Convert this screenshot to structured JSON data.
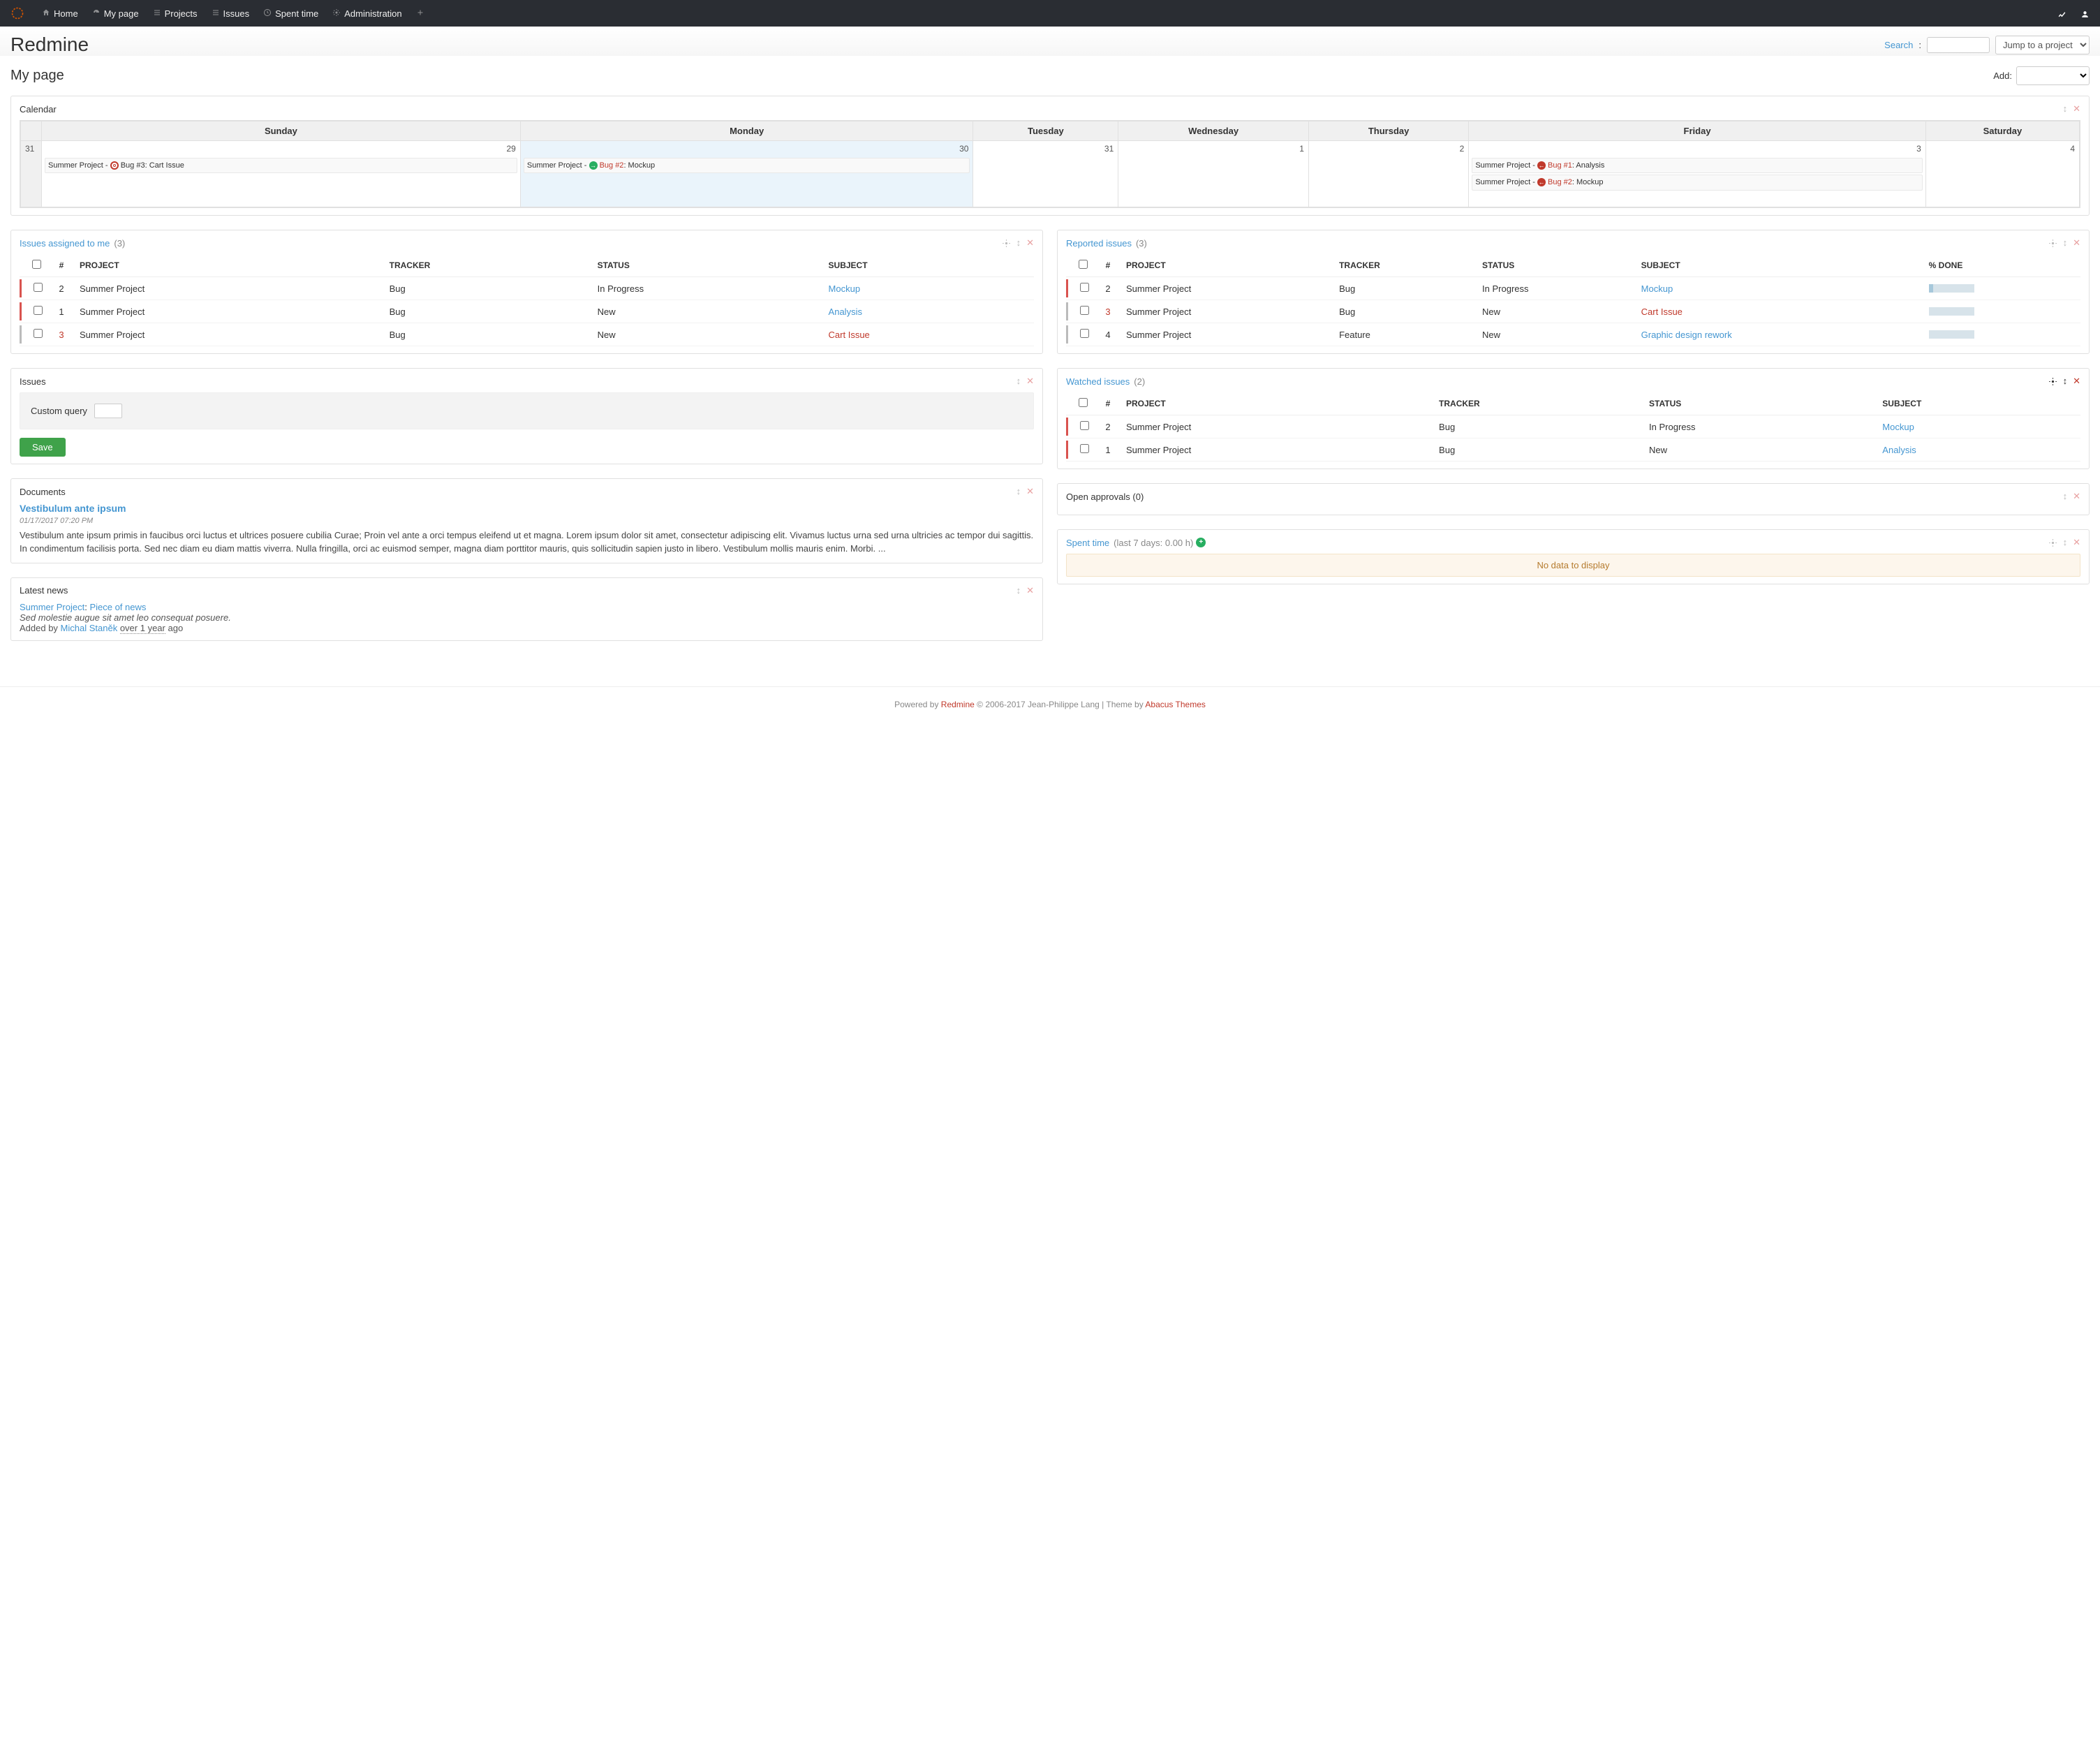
{
  "nav": {
    "items": [
      {
        "label": "Home",
        "icon": "home"
      },
      {
        "label": "My page",
        "icon": "dashboard"
      },
      {
        "label": "Projects",
        "icon": "list"
      },
      {
        "label": "Issues",
        "icon": "list"
      },
      {
        "label": "Spent time",
        "icon": "clock"
      },
      {
        "label": "Administration",
        "icon": "gear"
      }
    ]
  },
  "header": {
    "app_title": "Redmine",
    "search_label": "Search",
    "jump_placeholder": "Jump to a project..."
  },
  "page": {
    "title": "My page",
    "add_label": "Add:"
  },
  "calendar": {
    "title": "Calendar",
    "days": [
      "Sunday",
      "Monday",
      "Tuesday",
      "Wednesday",
      "Thursday",
      "Friday",
      "Saturday"
    ],
    "week_number": "31",
    "cells": [
      {
        "num": "29",
        "today": false,
        "events": [
          {
            "project": "Summer Project",
            "issue": "Bug #3",
            "subject": "Cart Issue",
            "icon": "target",
            "link_color": "black"
          }
        ]
      },
      {
        "num": "30",
        "today": true,
        "events": [
          {
            "project": "Summer Project",
            "issue": "Bug #2",
            "subject": "Mockup",
            "icon": "go",
            "link_color": "red"
          }
        ]
      },
      {
        "num": "31",
        "today": false,
        "events": []
      },
      {
        "num": "1",
        "today": false,
        "events": []
      },
      {
        "num": "2",
        "today": false,
        "events": []
      },
      {
        "num": "3",
        "today": false,
        "events": [
          {
            "project": "Summer Project",
            "issue": "Bug #1",
            "subject": "Analysis",
            "icon": "back",
            "link_color": "red"
          },
          {
            "project": "Summer Project",
            "issue": "Bug #2",
            "subject": "Mockup",
            "icon": "back",
            "link_color": "red"
          }
        ]
      },
      {
        "num": "4",
        "today": false,
        "events": []
      }
    ]
  },
  "assigned": {
    "title": "Issues assigned to me",
    "count": "(3)",
    "headers": [
      "#",
      "PROJECT",
      "TRACKER",
      "STATUS",
      "SUBJECT"
    ],
    "rows": [
      {
        "priority": "red",
        "id": "2",
        "project": "Summer Project",
        "tracker": "Bug",
        "status": "In Progress",
        "subject": "Mockup",
        "subject_color": "link"
      },
      {
        "priority": "red",
        "id": "1",
        "project": "Summer Project",
        "tracker": "Bug",
        "status": "New",
        "subject": "Analysis",
        "subject_color": "link"
      },
      {
        "priority": "grey",
        "id": "3",
        "id_color": "red",
        "project": "Summer Project",
        "tracker": "Bug",
        "status": "New",
        "subject": "Cart Issue",
        "subject_color": "red"
      }
    ]
  },
  "reported": {
    "title": "Reported issues",
    "count": "(3)",
    "headers": [
      "#",
      "PROJECT",
      "TRACKER",
      "STATUS",
      "SUBJECT",
      "% DONE"
    ],
    "rows": [
      {
        "priority": "red",
        "id": "2",
        "project": "Summer Project",
        "tracker": "Bug",
        "status": "In Progress",
        "subject": "Mockup",
        "subject_color": "link",
        "done": 10
      },
      {
        "priority": "grey",
        "id": "3",
        "id_color": "red",
        "project": "Summer Project",
        "tracker": "Bug",
        "status": "New",
        "subject": "Cart Issue",
        "subject_color": "red",
        "done": 0
      },
      {
        "priority": "grey",
        "id": "4",
        "project": "Summer Project",
        "tracker": "Feature",
        "status": "New",
        "subject": "Graphic design rework",
        "subject_color": "link",
        "done": 0
      }
    ]
  },
  "issues_box": {
    "title": "Issues",
    "query_label": "Custom query",
    "save_label": "Save"
  },
  "watched": {
    "title": "Watched issues",
    "count": "(2)",
    "headers": [
      "#",
      "PROJECT",
      "TRACKER",
      "STATUS",
      "SUBJECT"
    ],
    "rows": [
      {
        "priority": "red",
        "id": "2",
        "project": "Summer Project",
        "tracker": "Bug",
        "status": "In Progress",
        "subject": "Mockup"
      },
      {
        "priority": "red",
        "id": "1",
        "project": "Summer Project",
        "tracker": "Bug",
        "status": "New",
        "subject": "Analysis"
      }
    ]
  },
  "approvals": {
    "title": "Open approvals (0)"
  },
  "documents": {
    "title": "Documents",
    "doc_title": "Vestibulum ante ipsum",
    "date": "01/17/2017 07:20 PM",
    "body": "Vestibulum ante ipsum primis in faucibus orci luctus et ultrices posuere cubilia Curae; Proin vel ante a orci tempus eleifend ut et magna. Lorem ipsum dolor sit amet, consectetur adipiscing elit. Vivamus luctus urna sed urna ultricies ac tempor dui sagittis. In condimentum facilisis porta. Sed nec diam eu diam mattis viverra. Nulla fringilla, orci ac euismod semper, magna diam porttitor mauris, quis sollicitudin sapien justo in libero. Vestibulum mollis mauris enim. Morbi. ..."
  },
  "news": {
    "title": "Latest news",
    "project": "Summer Project",
    "headline": "Piece of news",
    "summary": "Sed molestie augue sit amet leo consequat posuere.",
    "added_prefix": "Added by ",
    "author": "Michal Staněk",
    "when": "over 1 year",
    "ago": " ago"
  },
  "spent": {
    "title": "Spent time",
    "subtitle": "(last 7 days: 0.00 h)",
    "nodata": "No data to display"
  },
  "footer": {
    "powered": "Powered by ",
    "redmine": "Redmine",
    "copyright": " © 2006-2017 Jean-Philippe Lang | Theme by ",
    "theme": "Abacus Themes"
  }
}
